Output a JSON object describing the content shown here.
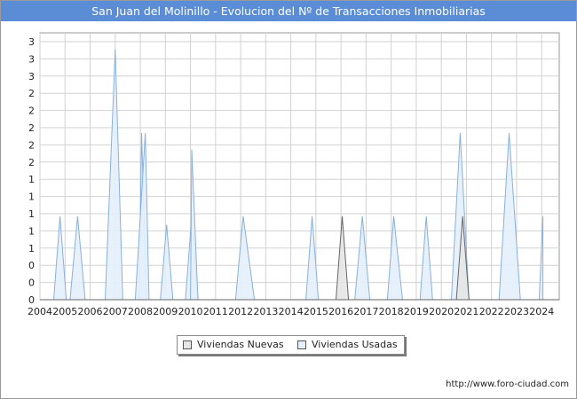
{
  "title": "San Juan del Molinillo - Evolucion del Nº de Transacciones Inmobiliarias",
  "source": "http://www.foro-ciudad.com",
  "colors": {
    "title_bg": "#5b8dd6",
    "nuevas_fill": "#e6e6e6",
    "nuevas_line": "#666666",
    "usadas_fill": "#e3effc",
    "usadas_line": "#8ab0da",
    "grid": "#d2d2d2"
  },
  "chart_data": {
    "type": "area",
    "title": "San Juan del Molinillo - Evolucion del Nº de Transacciones Inmobiliarias",
    "xlabel": "",
    "ylabel": "",
    "x_ticks": [
      "2004",
      "2005",
      "2006",
      "2007",
      "2008",
      "2009",
      "2010",
      "2011",
      "2012",
      "2013",
      "2014",
      "2015",
      "2016",
      "2017",
      "2018",
      "2019",
      "2020",
      "2021",
      "2022",
      "2023",
      "2024"
    ],
    "y_ticks": [
      "0",
      "0",
      "0",
      "1",
      "1",
      "1",
      "1",
      "1",
      "2",
      "2",
      "2",
      "2",
      "2",
      "3",
      "3",
      "3"
    ],
    "ylim": [
      0,
      3.2
    ],
    "grid": true,
    "legend_position": "bottom",
    "series": [
      {
        "name": "Viviendas Nuevas",
        "peaks": [
          {
            "start": 2015.8,
            "peak": 2016.05,
            "end": 2016.3,
            "value": 1
          },
          {
            "start": 2020.6,
            "peak": 2020.85,
            "end": 2021.1,
            "value": 1
          }
        ]
      },
      {
        "name": "Viviendas Usadas",
        "peaks": [
          {
            "start": 2004.55,
            "peak": 2004.8,
            "end": 2005.05,
            "value": 1
          },
          {
            "start": 2005.2,
            "peak": 2005.5,
            "end": 2005.8,
            "value": 1
          },
          {
            "start": 2006.6,
            "peak": 2007.0,
            "end": 2007.3,
            "value": 3
          },
          {
            "start": 2007.95,
            "peak": 2008.05,
            "end": 2008.25,
            "value": 2
          },
          {
            "start": 2007.8,
            "peak": 2008.2,
            "end": 2008.35,
            "value": 2
          },
          {
            "start": 2009.8,
            "peak": 2010.05,
            "end": 2010.3,
            "value": 1
          },
          {
            "start": 2010.0,
            "peak": 2010.05,
            "end": 2010.3,
            "value": 1.8
          },
          {
            "start": 2008.8,
            "peak": 2009.05,
            "end": 2009.3,
            "value": 0.9
          },
          {
            "start": 2011.8,
            "peak": 2012.1,
            "end": 2012.55,
            "value": 1
          },
          {
            "start": 2014.6,
            "peak": 2014.85,
            "end": 2015.1,
            "value": 1
          },
          {
            "start": 2016.55,
            "peak": 2016.85,
            "end": 2017.15,
            "value": 1
          },
          {
            "start": 2017.85,
            "peak": 2018.1,
            "end": 2018.45,
            "value": 1
          },
          {
            "start": 2019.15,
            "peak": 2019.4,
            "end": 2019.65,
            "value": 1
          },
          {
            "start": 2020.4,
            "peak": 2020.75,
            "end": 2021.1,
            "value": 2
          },
          {
            "start": 2022.3,
            "peak": 2022.7,
            "end": 2023.15,
            "value": 2
          },
          {
            "start": 2023.9,
            "peak": 2024.05,
            "end": 2024.05,
            "value": 1
          }
        ]
      }
    ]
  }
}
